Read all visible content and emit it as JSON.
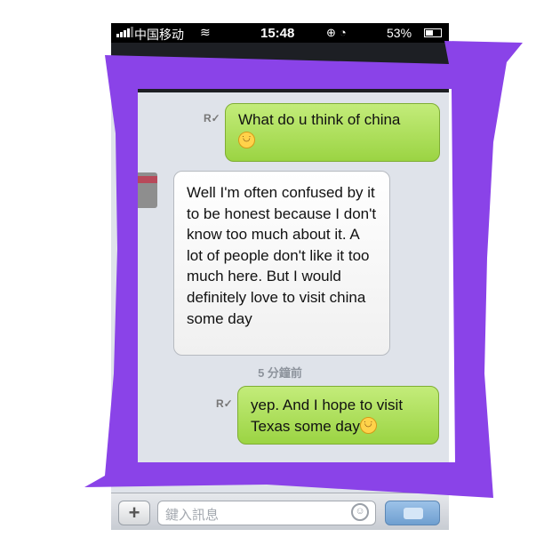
{
  "status_bar": {
    "carrier": "中国移动",
    "time": "15:48",
    "battery": "53%",
    "battery_level": 0.53
  },
  "chat": {
    "messages": [
      {
        "direction": "outgoing",
        "text": "What do u think of china",
        "has_emoji": true,
        "read_mark": "R✓"
      },
      {
        "direction": "incoming",
        "text": "Well I'm often confused by it to be honest because I don't know too much about it. A lot of people don't like it too much here. But I would definitely love to visit china some day",
        "has_emoji": false
      },
      {
        "direction": "outgoing",
        "text": "yep. And I hope to visit Texas some day",
        "has_emoji": true,
        "read_mark": "R✓"
      }
    ],
    "timestamp": "5 分鐘前"
  },
  "input": {
    "plus_label": "+",
    "placeholder": "鍵入訊息"
  },
  "colors": {
    "outgoing_bubble": "#b4e35f",
    "incoming_bubble": "#ffffff",
    "chat_background": "#dfe3ea",
    "scribble": "#8a43e8",
    "send_button": "#85afd9"
  },
  "icons": [
    "signal-icon",
    "wifi-icon",
    "lock-rotation-icon",
    "alarm-icon",
    "battery-icon",
    "smiley-icon",
    "read-receipt-icon",
    "plus-icon",
    "emoji-icon",
    "send-icon"
  ]
}
